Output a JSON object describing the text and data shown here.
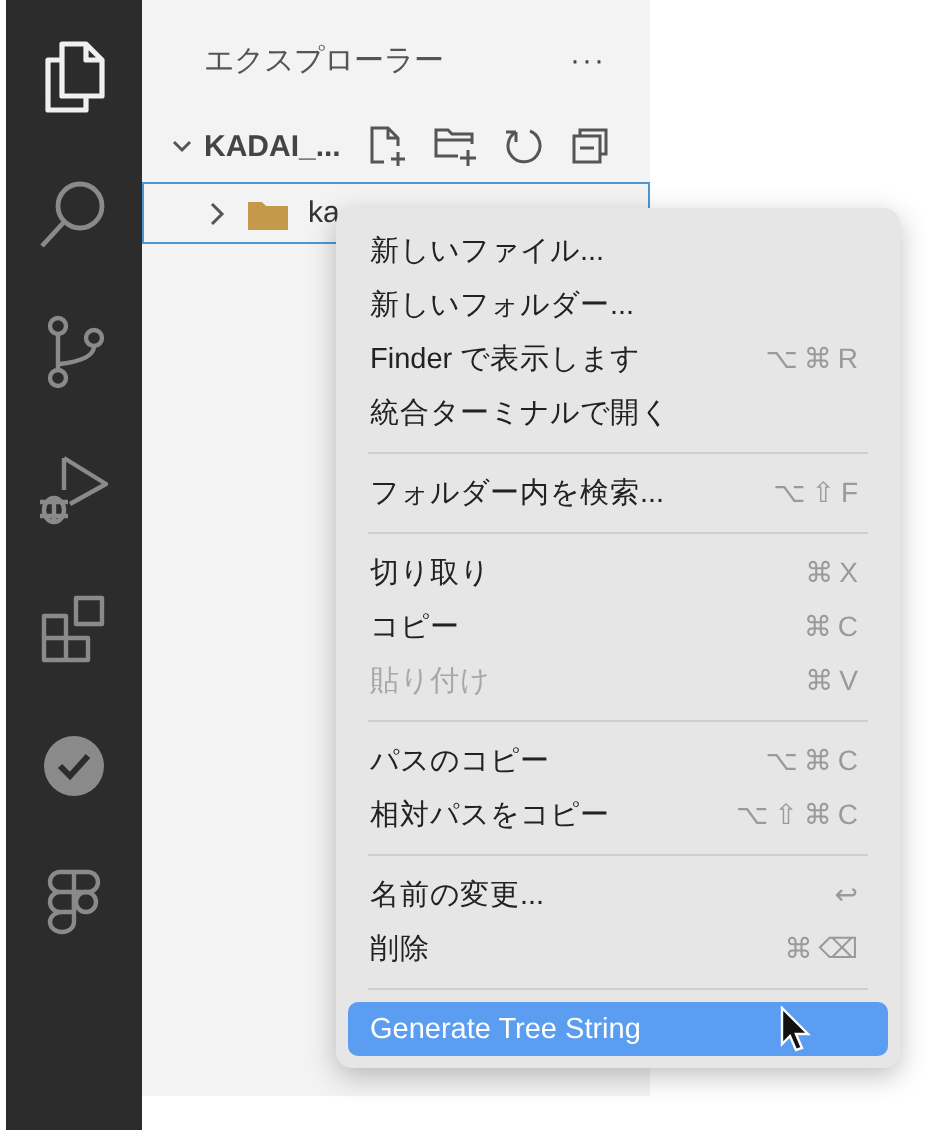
{
  "activity_bar": [
    {
      "kind": "files",
      "selected": true
    },
    {
      "kind": "search",
      "selected": false
    },
    {
      "kind": "branch",
      "selected": false
    },
    {
      "kind": "debug",
      "selected": false
    },
    {
      "kind": "extensions",
      "selected": false
    },
    {
      "kind": "check",
      "selected": false
    },
    {
      "kind": "figma",
      "selected": false
    }
  ],
  "sidebar": {
    "title": "エクスプローラー",
    "more": "···",
    "section": {
      "title": "KADAI_...",
      "expanded": true
    },
    "items": [
      {
        "label": "ka",
        "expanded": false,
        "selected": true
      }
    ]
  },
  "context_menu": {
    "groups": [
      [
        {
          "label": "新しいファイル...",
          "disabled": false,
          "selected": false
        },
        {
          "label": "新しいフォルダー...",
          "disabled": false,
          "selected": false
        },
        {
          "label": "Finder で表示します",
          "shortcut": "⌥⌘R",
          "disabled": false,
          "selected": false
        },
        {
          "label": "統合ターミナルで開く",
          "disabled": false,
          "selected": false
        }
      ],
      [
        {
          "label": "フォルダー内を検索...",
          "shortcut": "⌥⇧F",
          "disabled": false,
          "selected": false
        }
      ],
      [
        {
          "label": "切り取り",
          "shortcut": "⌘X",
          "disabled": false,
          "selected": false
        },
        {
          "label": "コピー",
          "shortcut": "⌘C",
          "disabled": false,
          "selected": false
        },
        {
          "label": "貼り付け",
          "shortcut": "⌘V",
          "disabled": true,
          "selected": false
        }
      ],
      [
        {
          "label": "パスのコピー",
          "shortcut": "⌥⌘C",
          "disabled": false,
          "selected": false
        },
        {
          "label": "相対パスをコピー",
          "shortcut": "⌥⇧⌘C",
          "disabled": false,
          "selected": false
        }
      ],
      [
        {
          "label": "名前の変更...",
          "shortcut": "↩",
          "disabled": false,
          "selected": false
        },
        {
          "label": "削除",
          "shortcut": "⌘⌫",
          "disabled": false,
          "selected": false
        }
      ],
      [
        {
          "label": "Generate Tree String",
          "disabled": false,
          "selected": true
        }
      ]
    ]
  }
}
